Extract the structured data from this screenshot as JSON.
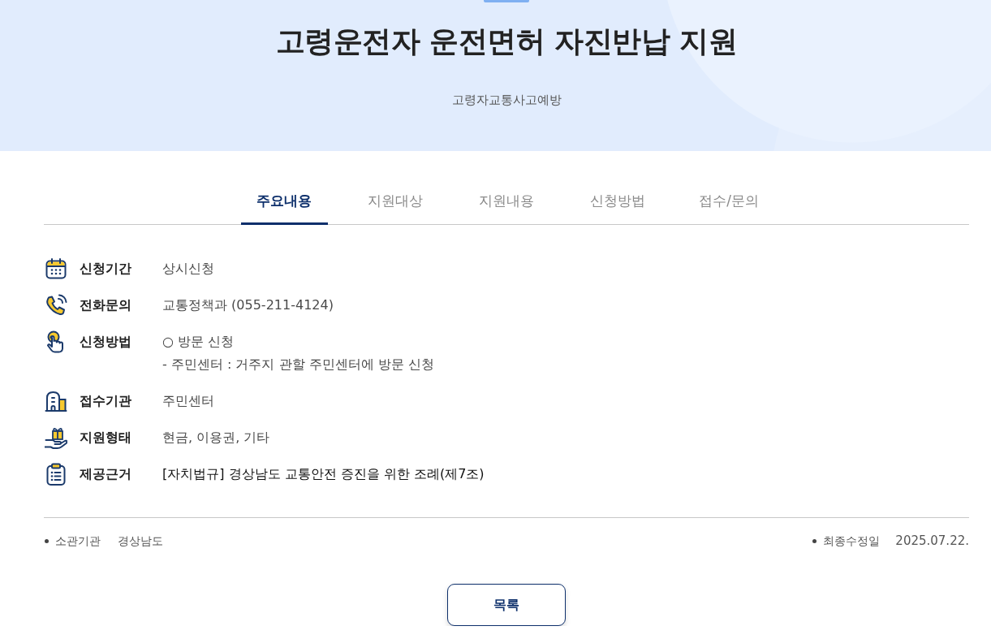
{
  "header": {
    "title": "고령운전자 운전면허 자진반납 지원",
    "subtitle": "고령자교통사고예방"
  },
  "tabs": [
    {
      "label": "주요내용",
      "selected": true
    },
    {
      "label": "지원대상",
      "selected": false
    },
    {
      "label": "지원내용",
      "selected": false
    },
    {
      "label": "신청방법",
      "selected": false
    },
    {
      "label": "접수/문의",
      "selected": false
    }
  ],
  "details": [
    {
      "kind": "text",
      "label": "신청기간",
      "lines": [
        "상시신청"
      ]
    },
    {
      "kind": "text",
      "label": "전화문의",
      "lines": [
        "교통정책과 (055-211-4124)"
      ]
    },
    {
      "kind": "text",
      "label": "신청방법",
      "lines": [
        "○ 방문 신청",
        "- 주민센터 : 거주지 관할 주민센터에 방문 신청"
      ]
    },
    {
      "kind": "text",
      "label": "접수기관",
      "lines": [
        "주민센터"
      ]
    },
    {
      "kind": "text",
      "label": "지원형태",
      "lines": [
        "현금, 이용권, 기타"
      ]
    },
    {
      "kind": "link",
      "label": "제공근거",
      "lines": [
        "[자치법규] 경상남도 교통안전 증진을 위한 조례(제7조)"
      ]
    }
  ],
  "footer": {
    "agency_label": "소관기관",
    "agency": "경상남도",
    "modified_label": "최종수정일",
    "modified": "2025.07.22."
  },
  "list_button": "목록"
}
